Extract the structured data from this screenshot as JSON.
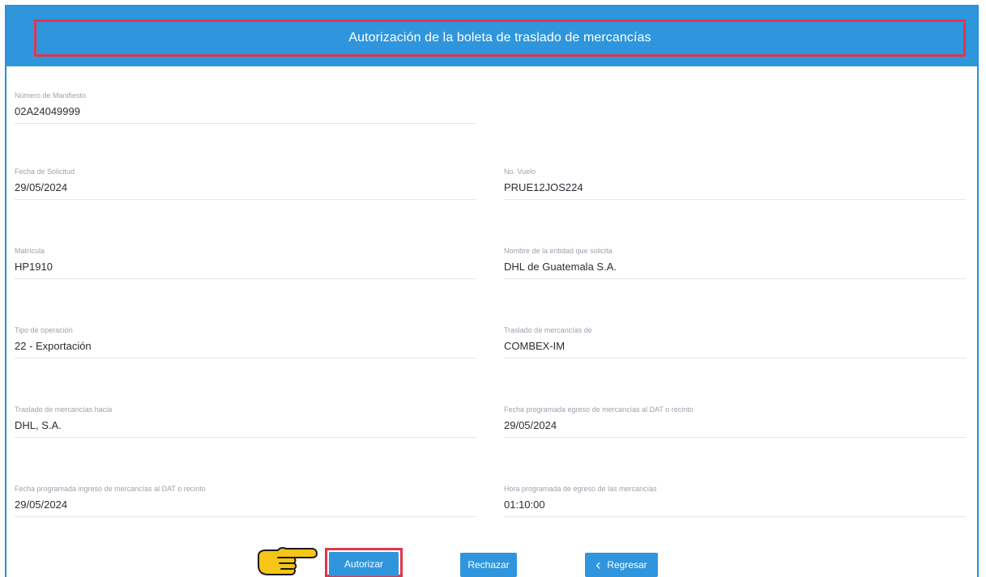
{
  "header": {
    "title": "Autorización de la boleta de traslado de mercancías"
  },
  "fields": {
    "manifiesto": {
      "label": "Número de Manifiesto",
      "value": "02A24049999"
    },
    "fecha_solicitud": {
      "label": "Fecha de Solicitud",
      "value": "29/05/2024"
    },
    "no_vuelo": {
      "label": "No. Vuelo",
      "value": "PRUE12JOS224"
    },
    "matricula": {
      "label": "Matrícula",
      "value": "HP1910"
    },
    "entidad": {
      "label": "Nombre de la entidad que solicita",
      "value": "DHL de Guatemala S.A."
    },
    "tipo_operacion": {
      "label": "Tipo de operación",
      "value": "22 - Exportación"
    },
    "traslado_de": {
      "label": "Traslado de mercancías de",
      "value": "COMBEX-IM"
    },
    "traslado_hacia": {
      "label": "Traslado de mercancías hacia",
      "value": "DHL, S.A."
    },
    "fecha_egreso": {
      "label": "Fecha programada egreso de mercancías al DAT o recinto",
      "value": "29/05/2024"
    },
    "fecha_ingreso": {
      "label": "Fecha programada ingreso de mercancías al DAT o recinto",
      "value": "29/05/2024"
    },
    "hora_egreso": {
      "label": "Hora programada de egreso de las mercancías",
      "value": "01:10:00"
    }
  },
  "actions": {
    "autorizar": "Autorizar",
    "rechazar": "Rechazar",
    "regresar": "Regresar"
  },
  "colors": {
    "accent": "#2f96dd",
    "highlight": "#e2364a",
    "hand": "#f5c518"
  },
  "icons": {
    "pointer": "pointing-hand-icon",
    "back": "chevron-left-icon"
  }
}
